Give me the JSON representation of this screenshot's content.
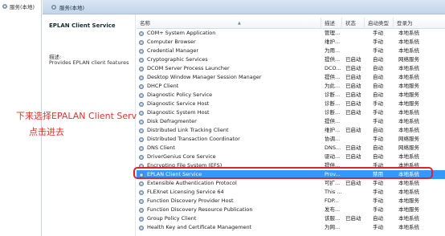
{
  "tree": {
    "label": "服务(本地)"
  },
  "header": {
    "label": "服务(本地)"
  },
  "details": {
    "title": "EPLAN Client Service",
    "desc_label": "描述:",
    "desc_text": "Provides EPLAN client features"
  },
  "annotation": {
    "line1": "下来选择EPALAN Client Service",
    "line2": "点击进去",
    "color": "#e0342b"
  },
  "columns": {
    "name": "名称",
    "desc": "描述",
    "status": "状态",
    "start": "启动类型",
    "logon": "登录为"
  },
  "services": [
    {
      "name": "COM+ System Application",
      "desc": "管理...",
      "status": "",
      "start": "手动",
      "logon": "本地系统"
    },
    {
      "name": "Computer Browser",
      "desc": "维护...",
      "status": "",
      "start": "手动",
      "logon": "本地系统"
    },
    {
      "name": "Credential Manager",
      "desc": "为用...",
      "status": "",
      "start": "手动",
      "logon": "本地系统"
    },
    {
      "name": "Cryptographic Services",
      "desc": "提供...",
      "status": "已启动",
      "start": "自动",
      "logon": "网络服务"
    },
    {
      "name": "DCOM Server Process Launcher",
      "desc": "DCO...",
      "status": "已启动",
      "start": "自动",
      "logon": "本地系统"
    },
    {
      "name": "Desktop Window Manager Session Manager",
      "desc": "提供...",
      "status": "已启动",
      "start": "自动",
      "logon": "本地系统"
    },
    {
      "name": "DHCP Client",
      "desc": "为此...",
      "status": "已启动",
      "start": "自动",
      "logon": "本地服务"
    },
    {
      "name": "Diagnostic Policy Service",
      "desc": "诊断...",
      "status": "已启动",
      "start": "自动",
      "logon": "本地服务"
    },
    {
      "name": "Diagnostic Service Host",
      "desc": "诊断...",
      "status": "已启动",
      "start": "手动",
      "logon": "本地服务"
    },
    {
      "name": "Diagnostic System Host",
      "desc": "诊断...",
      "status": "已启动",
      "start": "手动",
      "logon": "本地系统"
    },
    {
      "name": "Disk Defragmenter",
      "desc": "提供...",
      "status": "",
      "start": "手动",
      "logon": "本地系统"
    },
    {
      "name": "Distributed Link Tracking Client",
      "desc": "维护...",
      "status": "已启动",
      "start": "自动",
      "logon": "本地系统"
    },
    {
      "name": "Distributed Transaction Coordinator",
      "desc": "协调...",
      "status": "",
      "start": "手动",
      "logon": "网络服务"
    },
    {
      "name": "DNS Client",
      "desc": "DNS...",
      "status": "已启动",
      "start": "自动",
      "logon": "网络服务"
    },
    {
      "name": "DriverGenius Core Service",
      "desc": "驱动...",
      "status": "已启动",
      "start": "自动",
      "logon": "本地系统"
    },
    {
      "name": "Encrypting File System (EFS)",
      "desc": "提供...",
      "status": "",
      "start": "手动",
      "logon": "本地系统"
    },
    {
      "name": "EPLAN Client Service",
      "desc": "Prov...",
      "status": "",
      "start": "禁用",
      "logon": "本地系统",
      "selected": true
    },
    {
      "name": "Extensible Authentication Protocol",
      "desc": "可扩...",
      "status": "已启动",
      "start": "手动",
      "logon": "本地系统"
    },
    {
      "name": "FLEXnet Licensing Service 64",
      "desc": "This ...",
      "status": "",
      "start": "手动",
      "logon": "本地系统"
    },
    {
      "name": "Function Discovery Provider Host",
      "desc": "FDP...",
      "status": "",
      "start": "手动",
      "logon": "本地服务"
    },
    {
      "name": "Function Discovery Resource Publication",
      "desc": "发布...",
      "status": "",
      "start": "手动",
      "logon": "本地服务"
    },
    {
      "name": "Group Policy Client",
      "desc": "该服...",
      "status": "已启动",
      "start": "自动",
      "logon": "本地系统"
    },
    {
      "name": "Health Key and Certificate Management",
      "desc": "为网...",
      "status": "",
      "start": "手动",
      "logon": "本地系统"
    }
  ]
}
